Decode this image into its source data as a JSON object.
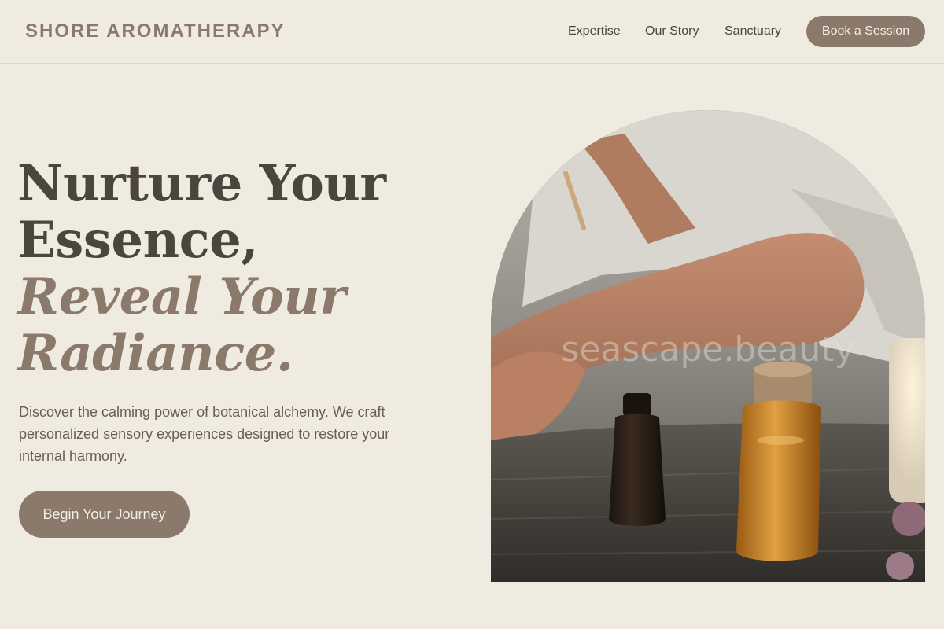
{
  "header": {
    "brand": "SHORE AROMATHERAPY",
    "nav": [
      {
        "label": "Expertise"
      },
      {
        "label": "Our Story"
      },
      {
        "label": "Sanctuary"
      }
    ],
    "book_label": "Book a Session"
  },
  "hero": {
    "headline_line1": "Nurture Your",
    "headline_line2": "Essence,",
    "headline_line3": "Reveal Your",
    "headline_line4": "Radiance.",
    "intro": "Discover the calming power of botanical alchemy. We craft personalized sensory experiences designed to restore your internal harmony.",
    "cta_label": "Begin Your Journey",
    "image_watermark": "seascape.beauty"
  },
  "colors": {
    "background": "#f0ebe1",
    "accent": "#8b7a6c",
    "text_dark": "#4a453d",
    "text_body": "#6a5e54"
  },
  "icons": {
    "hero_image": "aromatherapy-oils-photo"
  }
}
